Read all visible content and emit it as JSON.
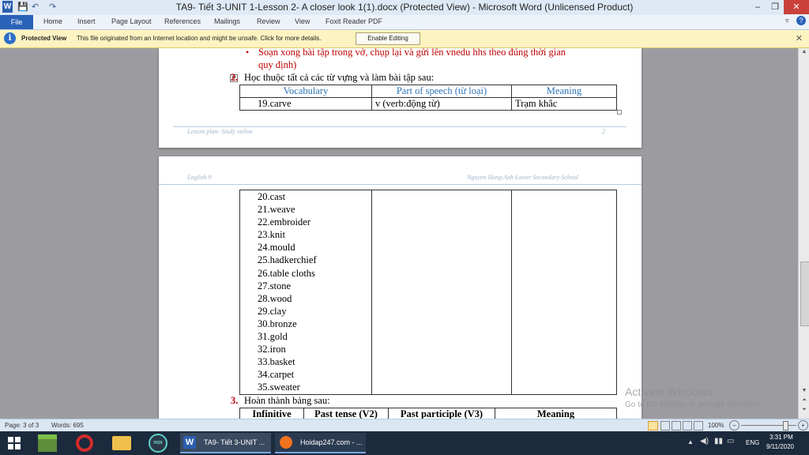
{
  "window": {
    "title": "TA9- Tiết 3-UNIT 1-Lesson 2- A closer look 1(1).docx (Protected View)  -  Microsoft Word (Unlicensed Product)",
    "minimize": "–",
    "restore": "❐",
    "close": "✕"
  },
  "quick_access": {
    "word_icon": "W",
    "save": "💾",
    "undo": "↶",
    "redo": "↷"
  },
  "ribbon": {
    "file": "File",
    "tabs": [
      "Home",
      "Insert",
      "Page Layout",
      "References",
      "Mailings",
      "Review",
      "View",
      "Foxit Reader PDF"
    ],
    "help": "?"
  },
  "protected_bar": {
    "icon": "i",
    "label": "Protected View",
    "message": "This file originated from an Internet location and might be unsafe. Click for more details.",
    "button": "Enable Editing",
    "close": "✕"
  },
  "page1": {
    "bullet_text_1": "Soạn xong bài tập trong vở, chụp lại và gửi lên vnedu hhs theo đúng thời gian",
    "bullet_text_2": "quy định)",
    "item_number": "2.",
    "item_text": "Học thuộc tất cả các từ vựng và làm bài tập sau:",
    "table_headers": [
      "Vocabulary",
      "Part of speech (từ loại)",
      "Meaning"
    ],
    "table_row": [
      "19.carve",
      "v (verb:động từ)",
      "Trạm khắc"
    ],
    "footer_left": "Lesson plan- Study online",
    "footer_right": "2"
  },
  "page2": {
    "header_left": "English 9",
    "header_right": "Nguyen Hong Anh Lower Secondary School",
    "vocab_items": [
      "20.cast",
      "21.weave",
      "22.embroider",
      "23.knit",
      "24.mould",
      "25.hadkerchief",
      "26.table cloths",
      "27.stone",
      "28.wood",
      "29.clay",
      "30.bronze",
      "31.gold",
      "32.iron",
      "33.basket",
      "34.carpet",
      "35.sweater"
    ],
    "item3_number": "3.",
    "item3_text": "Hoàn thành bảng sau:",
    "table2_headers": [
      "Infinitive",
      "Past tense (V2)",
      "Past participle (V3)",
      "Meaning"
    ]
  },
  "status": {
    "page": "Page: 3 of 3",
    "words": "Words: 695",
    "zoom": "100%",
    "zoom_minus": "–",
    "zoom_plus": "+",
    "zoom_level": 1.0
  },
  "watermark": {
    "line1": "Activate Windows",
    "line2": "Go to PC settings to activate Windows."
  },
  "taskbar": {
    "apps": [
      {
        "label": "TA9- Tiết 3-UNIT ..."
      },
      {
        "label": "Hoidap247.com - ..."
      }
    ],
    "language": "ENG",
    "time": "3:31 PM",
    "date": "9/11/2020"
  },
  "colors": {
    "heading_blue": "#2e74b5",
    "bullet_red": "#c00000",
    "file_tab": "#2a62b8",
    "protected_bar": "#fdf3c0"
  }
}
